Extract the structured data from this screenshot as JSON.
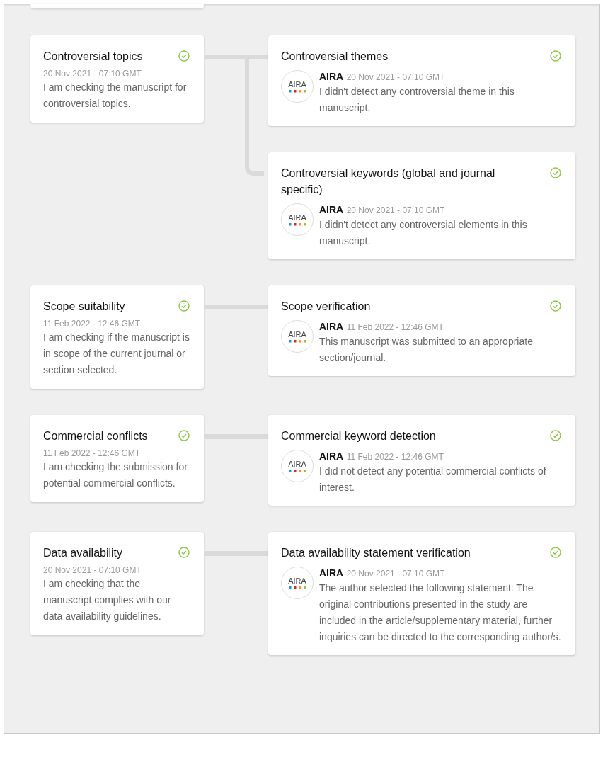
{
  "groups": [
    {
      "title": "Controversial topics",
      "passed": true,
      "date": "20 Nov 2021 - 07:10 GMT",
      "text": "I am checking the manuscript for controversial topics.",
      "checks": [
        {
          "title": "Controversial themes",
          "passed": true,
          "avatar_label": "AIRA",
          "author": "AIRA",
          "date": "20 Nov 2021 - 07:10 GMT",
          "text": "I didn't detect any controversial theme in this manuscript."
        },
        {
          "title": "Controversial keywords (global and journal specific)",
          "passed": true,
          "avatar_label": "AIRA",
          "author": "AIRA",
          "date": "20 Nov 2021 - 07:10 GMT",
          "text": "I didn't detect any controversial elements in this manuscript."
        }
      ]
    },
    {
      "title": "Scope suitability",
      "passed": true,
      "date": "11 Feb 2022 - 12:46 GMT",
      "text": "I am checking if the manuscript is in scope of the current journal or section selected.",
      "checks": [
        {
          "title": "Scope verification",
          "passed": true,
          "avatar_label": "AIRA",
          "author": "AIRA",
          "date": "11 Feb 2022 - 12:46 GMT",
          "text": "This manuscript was submitted to an appropriate section/journal."
        }
      ]
    },
    {
      "title": "Commercial conflicts",
      "passed": true,
      "date": "11 Feb 2022 - 12:46 GMT",
      "text": "I am checking the submission for potential commercial conflicts.",
      "checks": [
        {
          "title": "Commercial keyword detection",
          "passed": true,
          "avatar_label": "AIRA",
          "author": "AIRA",
          "date": "11 Feb 2022 - 12:46 GMT",
          "text": "I did not detect any potential commercial conflicts of interest."
        }
      ]
    },
    {
      "title": "Data availability",
      "passed": true,
      "date": "20 Nov 2021 - 07:10 GMT",
      "text": "I am checking that the manuscript complies with our data availability guidelines.",
      "checks": [
        {
          "title": "Data availability statement verification",
          "passed": true,
          "avatar_label": "AIRA",
          "author": "AIRA",
          "date": "20 Nov 2021 - 07:10 GMT",
          "text": "The author selected the following statement: The original contributions presented in the study are included in the article/supplementary material, further inquiries can be directed to the corresponding author/s."
        }
      ]
    }
  ]
}
